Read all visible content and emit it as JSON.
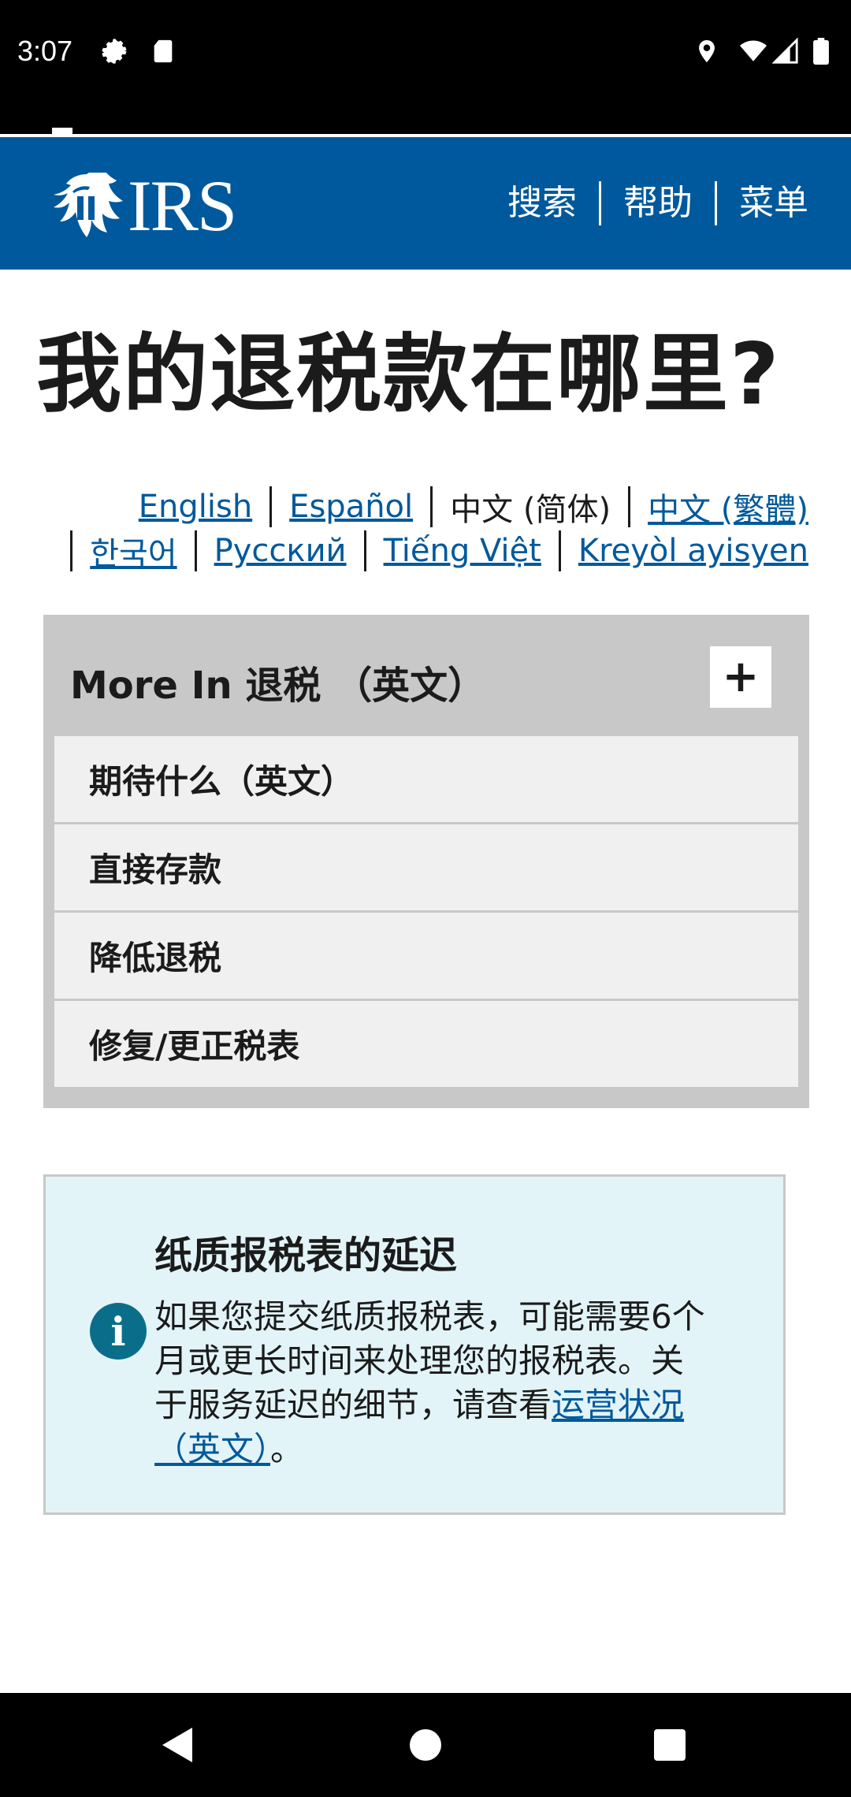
{
  "status_bar": {
    "time": "3:07",
    "left_icons": [
      "gear-icon",
      "sd-card-icon"
    ],
    "right_icons": [
      "location-icon",
      "wifi-icon",
      "signal-icon",
      "battery-icon"
    ]
  },
  "header": {
    "logo_text": "IRS",
    "nav": [
      {
        "label": "搜索"
      },
      {
        "label": "帮助"
      },
      {
        "label": "菜单"
      }
    ],
    "color": "#00599c"
  },
  "page_title": "我的退税款在哪里?",
  "languages": {
    "row1": [
      {
        "label": "English",
        "current": false
      },
      {
        "label": "Español",
        "current": false
      },
      {
        "label": "中文 (简体)",
        "current": true
      },
      {
        "label": "中文 (繁體)",
        "current": false
      }
    ],
    "row2": [
      {
        "label": "한국어",
        "current": false
      },
      {
        "label": "Русский",
        "current": false
      },
      {
        "label": "Tiếng Việt",
        "current": false
      },
      {
        "label": "Kreyòl ayisyen",
        "current": false
      }
    ]
  },
  "more_in": {
    "title": "More In 退税 （英文）",
    "toggle_label": "+",
    "items": [
      {
        "label": "期待什么（英文）"
      },
      {
        "label": "直接存款"
      },
      {
        "label": "降低退税"
      },
      {
        "label": "修复/更正税表"
      }
    ]
  },
  "alert": {
    "title": "纸质报税表的延迟",
    "icon": "info-icon",
    "body": "如果您提交纸质报税表，可能需要6个月或更长时间来处理您的报税表。关于服务延迟的细节，请查看",
    "link": "运营状况（英文）",
    "suffix": "。"
  }
}
